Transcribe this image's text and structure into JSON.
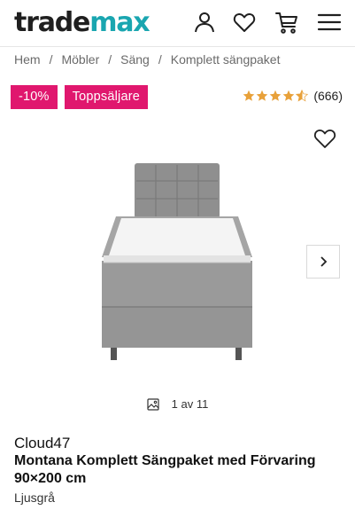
{
  "header": {
    "logo_part1": "trade",
    "logo_part2": "max",
    "icons": [
      "user-icon",
      "heart-icon",
      "cart-icon",
      "menu-icon"
    ]
  },
  "breadcrumb": {
    "items": [
      "Hem",
      "Möbler",
      "Säng",
      "Komplett sängpaket"
    ],
    "separator": "/"
  },
  "badges": {
    "discount": "-10%",
    "bestseller": "Toppsäljare"
  },
  "rating": {
    "stars": 4.5,
    "count": "(666)"
  },
  "gallery": {
    "current": "1 av 11"
  },
  "product": {
    "brand": "Cloud47",
    "title": "Montana Komplett Sängpaket med Förvaring 90×200 cm",
    "variant": "Ljusgrå"
  },
  "colors": {
    "logo_accent": "#1aa6b0",
    "badge": "#e0176e",
    "star": "#e8a13a"
  }
}
